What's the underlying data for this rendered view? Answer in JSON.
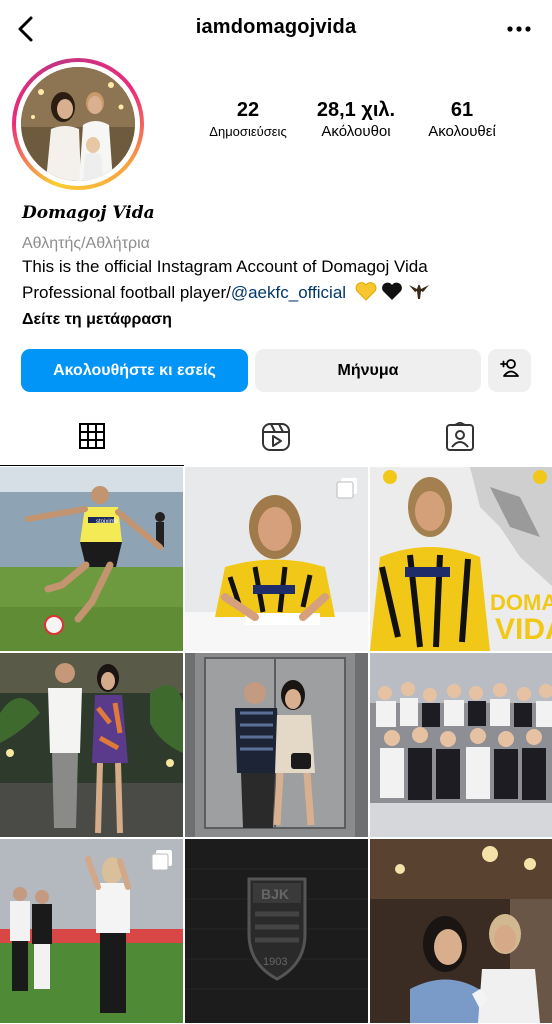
{
  "header": {
    "username": "iamdomagojvida",
    "back_icon": "chevron-left-icon",
    "more_icon": "more-horizontal-icon"
  },
  "profile": {
    "posts_count": "22",
    "posts_label": "Δημοσιεύσεις",
    "followers_count": "28,1 χιλ.",
    "followers_label": "Ακόλουθοι",
    "following_count": "61",
    "following_label": "Ακολουθεί",
    "display_name": "Domagoj Vida",
    "category": "Αθλητής/Αθλήτρια",
    "bio_line1": "This is the official Instagram Account of Domagoj Vida",
    "bio_line2_prefix": "Professional football player/",
    "bio_mention": "@aekfc_official",
    "bio_emojis": [
      "yellow-heart",
      "black-heart",
      "eagle"
    ],
    "translate_link": "Δείτε τη μετάφραση"
  },
  "actions": {
    "follow_label": "Ακολουθήστε κι εσείς",
    "message_label": "Μήνυμα",
    "add_user_icon": "add-user-icon"
  },
  "tabs": [
    {
      "name": "posts-grid",
      "icon": "grid-icon",
      "active": true
    },
    {
      "name": "reels",
      "icon": "reels-icon",
      "active": false
    },
    {
      "name": "tagged",
      "icon": "tagged-person-icon",
      "active": false
    }
  ],
  "posts": [
    {
      "scene": "football player kicking ball on pitch",
      "multi": false
    },
    {
      "scene": "player signing contract in AEK jersey",
      "multi": true
    },
    {
      "scene": "Domagoj Vida AEK announcement graphic",
      "multi": false
    },
    {
      "scene": "couple posing at evening event",
      "multi": false
    },
    {
      "scene": "mirror selfie in elevator",
      "multi": false
    },
    {
      "scene": "team celebration group photo",
      "multi": false
    },
    {
      "scene": "players applauding fans in stadium",
      "multi": true
    },
    {
      "scene": "Besiktas crest on dark wall",
      "multi": false
    },
    {
      "scene": "couple selfie in restaurant",
      "multi": false
    }
  ],
  "post_text": {
    "sponsor": "stoiximo",
    "promo_line1": "DOMAGOJ",
    "promo_line2": "VIDA",
    "crest_letters": "BJK",
    "crest_year": "1903"
  },
  "colors": {
    "primary_blue": "#0095f6",
    "secondary_gray": "#efefef",
    "muted_text": "#8e8e8e",
    "mention_blue": "#00376b",
    "aek_yellow": "#f5d000"
  }
}
